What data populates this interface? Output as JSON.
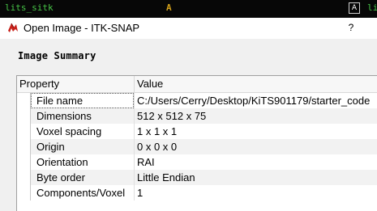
{
  "topbar": {
    "left_title": "lits_sitk",
    "center_mark": "A",
    "kb_icon": "A",
    "right_title": "li"
  },
  "window": {
    "title": "Open Image - ITK-SNAP",
    "help": "?",
    "app_icon": "itk-snap-logo-icon"
  },
  "summary": {
    "heading": "Image Summary",
    "columns": {
      "property": "Property",
      "value": "Value"
    },
    "rows": [
      {
        "property": "File name",
        "value": "C:/Users/Cerry/Desktop/KiTS901179/starter_code"
      },
      {
        "property": "Dimensions",
        "value": "512 x 512 x 75"
      },
      {
        "property": "Voxel spacing",
        "value": "1 x 1 x 1"
      },
      {
        "property": "Origin",
        "value": "0 x 0 x 0"
      },
      {
        "property": "Orientation",
        "value": "RAI"
      },
      {
        "property": "Byte order",
        "value": "Little Endian"
      },
      {
        "property": "Components/Voxel",
        "value": "1"
      }
    ]
  }
}
